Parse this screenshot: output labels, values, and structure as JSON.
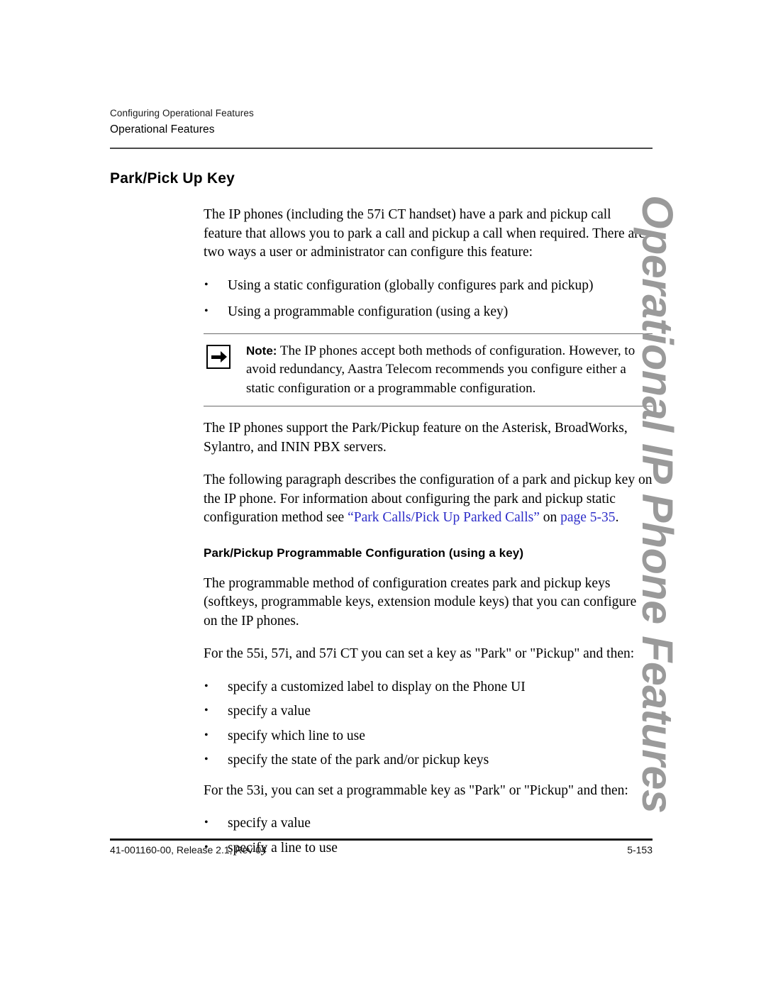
{
  "header": {
    "chapter_line": "Configuring Operational Features",
    "section_line": "Operational Features"
  },
  "title": "Park/Pick Up Key",
  "intro_paragraph": "The IP phones (including the 57i CT handset) have a park and pickup call feature that allows you to park a call and pickup a call when required. There are two ways a user or administrator can configure this feature:",
  "intro_bullets": [
    "Using a static configuration (globally configures park and pickup)",
    "Using a programmable configuration (using a key)"
  ],
  "note": {
    "label": "Note:",
    "icon": "right-arrow-icon",
    "text": "The IP phones accept both methods of configuration. However, to avoid redundancy, Aastra Telecom recommends you configure either a static configuration or a programmable configuration."
  },
  "support_paragraph": "The IP phones support the Park/Pickup feature on the Asterisk, BroadWorks, Sylantro, and ININ PBX servers.",
  "xref_paragraph": {
    "before": "The following paragraph describes the configuration of a park and pickup key on the IP phone. For information about configuring the park and pickup static configuration method see ",
    "link_text": "“Park Calls/Pick Up Parked Calls”",
    "middle": " on ",
    "page_link_text": "page 5-35",
    "after": ".",
    "link_color": "#2d2dc8"
  },
  "sub_heading": "Park/Pickup Programmable Configuration (using a key)",
  "programmable_paragraph": "The programmable method of configuration creates park and pickup keys (softkeys, programmable keys, extension module keys) that you can configure on the IP phones.",
  "phones_55i_intro": "For the 55i, 57i, and 57i CT you can set a key as \"Park\" or \"Pickup\" and then:",
  "phones_55i_bullets": [
    "specify a customized label to display on the Phone UI",
    "specify a value",
    "specify which line to use",
    "specify the state of the park and/or pickup keys"
  ],
  "phones_53i_intro": "For the 53i, you can set a programmable key as \"Park\" or \"Pickup\" and then:",
  "phones_53i_bullets": [
    "specify a value",
    "specify a line to use"
  ],
  "side_tab": {
    "text": "Operational IP Phone Features",
    "color": "#9a9a9a"
  },
  "footer": {
    "document_id": "41-001160-00, Release 2.1, Rev 04",
    "page_number": "5-153"
  }
}
